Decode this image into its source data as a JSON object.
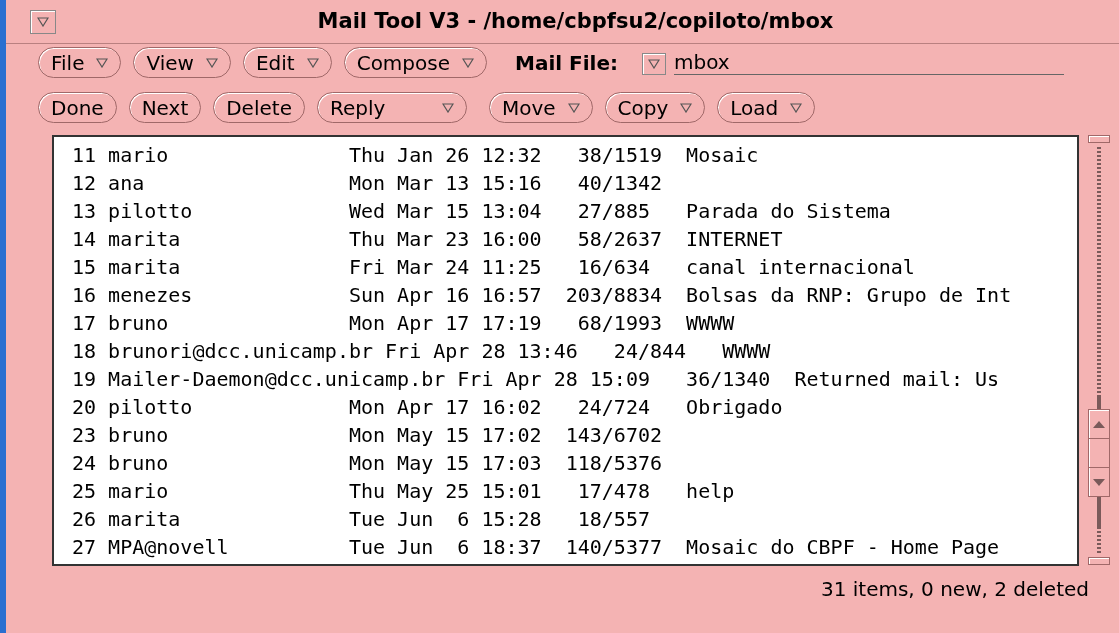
{
  "window": {
    "title": "Mail Tool V3 - /home/cbpfsu2/copiloto/mbox"
  },
  "toolbar_rows": [
    [
      {
        "label": "File",
        "menu": true
      },
      {
        "label": "View",
        "menu": true
      },
      {
        "label": "Edit",
        "menu": true
      },
      {
        "label": "Compose",
        "menu": true
      }
    ],
    [
      {
        "label": "Done",
        "menu": false
      },
      {
        "label": "Next",
        "menu": false
      },
      {
        "label": "Delete",
        "menu": false
      },
      {
        "label": "Reply",
        "menu": true,
        "wide": true
      },
      {
        "label": "Move",
        "menu": true
      },
      {
        "label": "Copy",
        "menu": true
      },
      {
        "label": "Load",
        "menu": true
      }
    ]
  ],
  "mail_file": {
    "label": "Mail File:",
    "value": "mbox"
  },
  "messages": [
    {
      "line": "11 mario               Thu Jan 26 12:32   38/1519  Mosaic"
    },
    {
      "line": "12 ana                 Mon Mar 13 15:16   40/1342"
    },
    {
      "line": "13 pilotto             Wed Mar 15 13:04   27/885   Parada do Sistema"
    },
    {
      "line": "14 marita              Thu Mar 23 16:00   58/2637  INTERNET"
    },
    {
      "line": "15 marita              Fri Mar 24 11:25   16/634   canal internacional"
    },
    {
      "line": "16 menezes             Sun Apr 16 16:57  203/8834  Bolsas da RNP: Grupo de Int"
    },
    {
      "line": "17 bruno               Mon Apr 17 17:19   68/1993  WWWW"
    },
    {
      "line": "18 brunori@dcc.unicamp.br Fri Apr 28 13:46   24/844   WWWW"
    },
    {
      "line": "19 Mailer-Daemon@dcc.unicamp.br Fri Apr 28 15:09   36/1340  Returned mail: Us"
    },
    {
      "line": "20 pilotto             Mon Apr 17 16:02   24/724   Obrigado"
    },
    {
      "line": "23 bruno               Mon May 15 17:02  143/6702"
    },
    {
      "line": "24 bruno               Mon May 15 17:03  118/5376"
    },
    {
      "line": "25 mario               Thu May 25 15:01   17/478   help"
    },
    {
      "line": "26 marita              Tue Jun  6 15:28   18/557"
    },
    {
      "line": "27 MPA@novell          Tue Jun  6 18:37  140/5377  Mosaic do CBPF - Home Page"
    }
  ],
  "status_bar": "31 items, 0 new, 2 deleted"
}
